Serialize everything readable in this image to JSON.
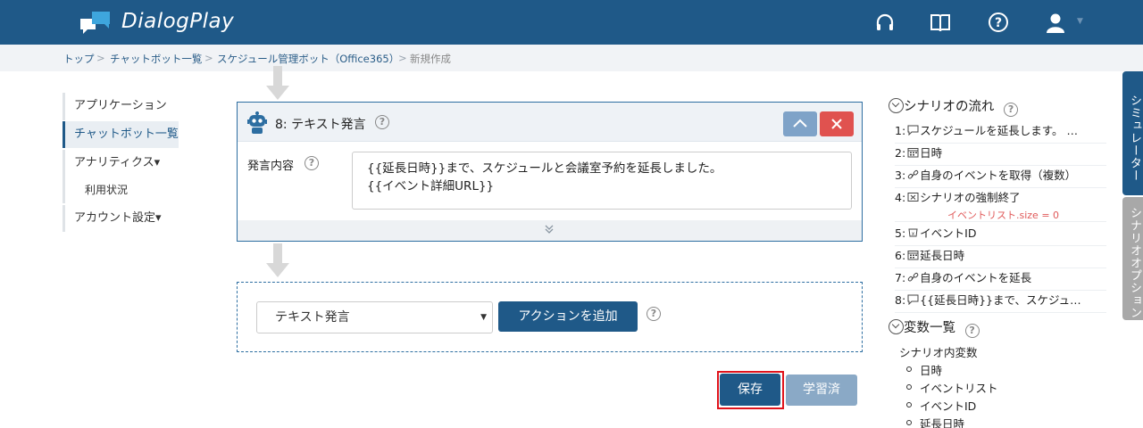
{
  "app": {
    "brand": "DialogPlay"
  },
  "header": {
    "icons": [
      "headset-icon",
      "manual-book-icon",
      "help-icon",
      "user-icon",
      "chevron-down-icon"
    ]
  },
  "breadcrumb": {
    "items": [
      "トップ",
      "チャットボット一覧",
      "スケジュール管理ボット（Office365）",
      "新規作成"
    ],
    "separator": ">"
  },
  "sidebar": {
    "items": [
      {
        "label": "アプリケーション"
      },
      {
        "label": "チャットボット一覧",
        "active": true
      },
      {
        "label": "アナリティクス▾"
      },
      {
        "label": "利用状況"
      },
      {
        "label": "アカウント設定▾"
      }
    ]
  },
  "action_card": {
    "title": "8: テキスト発言",
    "field_label": "発言内容",
    "message_text": "{{延長日時}}まで、スケジュールと会議室予約を延長しました。\n{{イベント詳細URL}}",
    "expand_icon": "double-chevron-down-icon"
  },
  "add_action": {
    "selected_type": "テキスト発言",
    "add_button": "アクションを追加"
  },
  "buttons": {
    "save": "保存",
    "learned": "学習済"
  },
  "scenario_flow": {
    "title": "シナリオの流れ",
    "steps": [
      {
        "num": "1:",
        "icon": "speech-bubble-icon",
        "text": "スケジュールを延長します。 …"
      },
      {
        "num": "2:",
        "icon": "calendar-icon",
        "text": "日時"
      },
      {
        "num": "3:",
        "icon": "link-icon",
        "text": "自身のイベントを取得（複数）"
      },
      {
        "num": "4:",
        "icon": "terminate-icon",
        "text": "シナリオの強制終了",
        "condition": "イベントリスト.size = 0"
      },
      {
        "num": "5:",
        "icon": "variable-icon",
        "text": "イベントID"
      },
      {
        "num": "6:",
        "icon": "calendar-icon",
        "text": "延長日時"
      },
      {
        "num": "7:",
        "icon": "link-icon",
        "text": "自身のイベントを延長"
      },
      {
        "num": "8:",
        "icon": "speech-bubble-icon",
        "text": "{{延長日時}}まで、スケジュ…"
      }
    ]
  },
  "variables": {
    "title": "変数一覧",
    "section": "シナリオ内変数",
    "items": [
      "日時",
      "イベントリスト",
      "イベントID",
      "延長日時"
    ]
  },
  "side_tabs": {
    "simulator": "シミュレーター",
    "scenario_options": "シナリオオプション"
  },
  "colors": {
    "primary": "#1f5988",
    "danger": "#e0524f",
    "muted_button": "#8aa9c6",
    "condition_text": "#e05a5a",
    "highlight_border": "#e0141c"
  }
}
